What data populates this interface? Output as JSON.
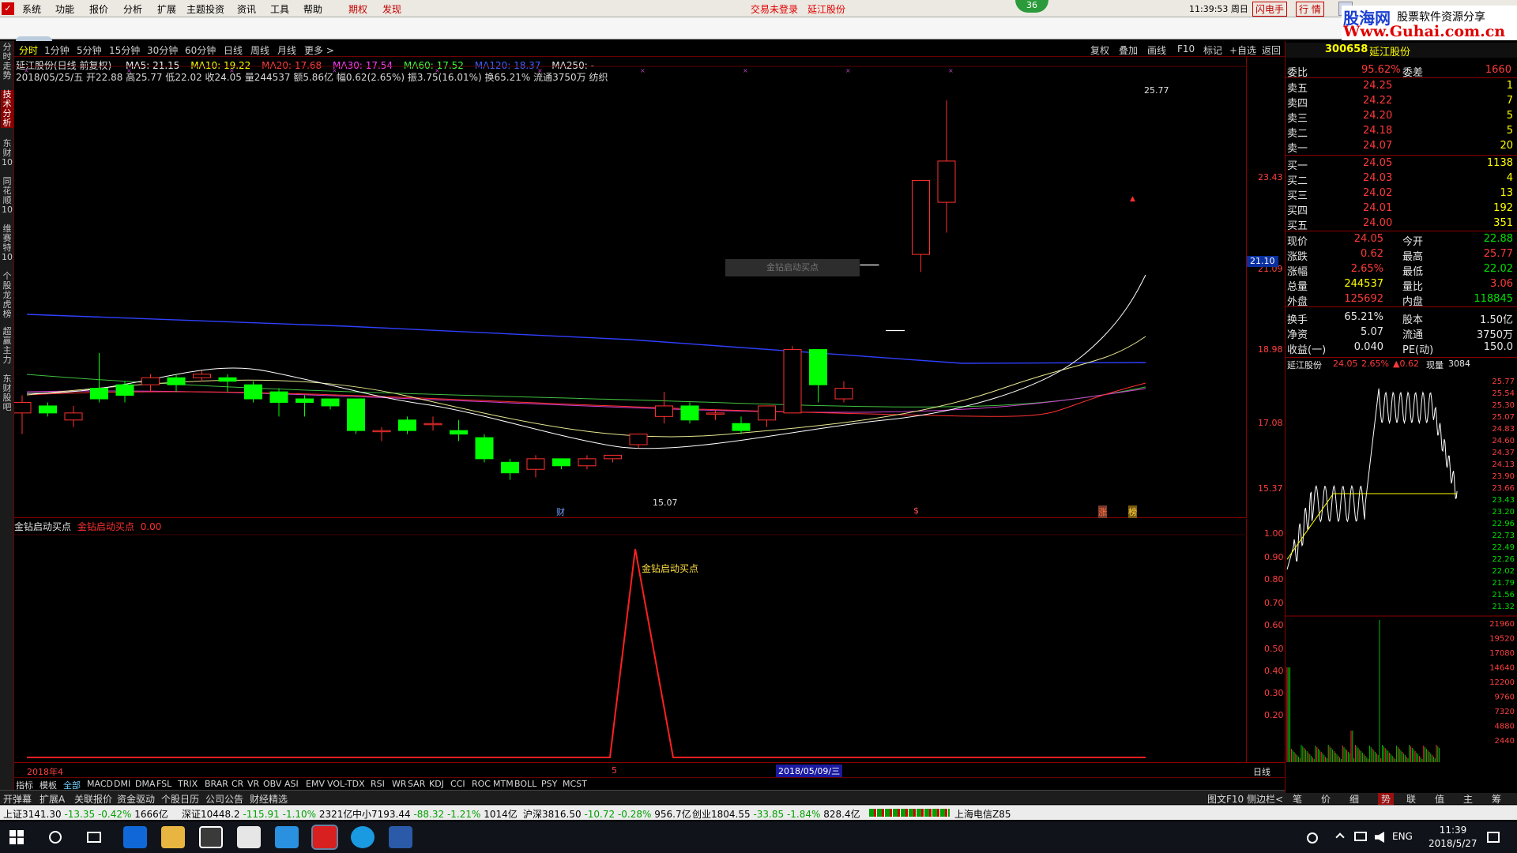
{
  "menu": {
    "items": [
      "系统",
      "功能",
      "报价",
      "分析",
      "扩展",
      "主题投资",
      "资讯",
      "工具",
      "帮助",
      "期权",
      "发现"
    ],
    "center_status": "交易未登录",
    "center_stock": "延江股份",
    "badge": "36",
    "time": "11:39:53 周日",
    "btn_flash": "闪电手",
    "btn_market": "行 情",
    "brand_top": "股海网",
    "brand_top2": "股票软件资源分享",
    "brand_url": "Www.Guhai.com.cn"
  },
  "periods": [
    "分时",
    "1分钟",
    "5分钟",
    "15分钟",
    "30分钟",
    "60分钟",
    "日线",
    "周线",
    "月线",
    "更多 >"
  ],
  "toolbar_right": [
    "复权",
    "叠加",
    "画线",
    "F10",
    "标记",
    "+自选",
    "返回"
  ],
  "left_rail": [
    "分时走势",
    "技术分析",
    "东财10",
    "同花顺10",
    "维赛特10",
    "个股龙虎榜",
    "超赢主力",
    "东财股吧"
  ],
  "chart_header": {
    "line1_name": "延江股份(日线 前复权)",
    "ma5": "MA5: 21.15",
    "ma10": "MA10: 19.22",
    "ma20": "MA20: 17.68",
    "ma30": "MA30: 17.54",
    "ma60": "MA60: 17.52",
    "ma120": "MA120: 18.37",
    "ma250": "MA250: -",
    "line2": "2018/05/25/五 开22.88 高25.77 低22.02 收24.05 量244537 额5.86亿 幅0.62(2.65%) 振3.75(16.01%) 换65.21% 流通3750万 纺织"
  },
  "main_labels": {
    "high_label": "25.77",
    "low_label": "15.07",
    "overlay_text": "金钻启动买点",
    "price_tag": "21.10",
    "bottom_marks": [
      "财",
      "$",
      "涨",
      "榜"
    ]
  },
  "y_axis_main": [
    "23.43",
    "21.09",
    "18.98",
    "17.08",
    "15.37"
  ],
  "sub_header": {
    "name": "金钻启动买点",
    "value_label": "金钻启动买点",
    "value": "0.00"
  },
  "sub_signal_text": "金钻启动买点",
  "y_axis_sub": [
    "1.00",
    "0.90",
    "0.80",
    "0.70",
    "0.60",
    "0.50",
    "0.40",
    "0.30",
    "0.20"
  ],
  "x_axis": {
    "left": "2018年4",
    "mid": "5",
    "date_box": "2018/05/09/三",
    "right": "日线"
  },
  "indicator_tabs": [
    "指标",
    "模板",
    "全部",
    "MACD",
    "DMI",
    "DMA",
    "FSL",
    "TRIX",
    "BRAR",
    "CR",
    "VR",
    "OBV",
    "ASI",
    "EMV",
    "VOL-TDX",
    "RSI",
    "WR",
    "SAR",
    "KDJ",
    "CCI",
    "ROC",
    "MTM",
    "BOLL",
    "PSY",
    "MCST"
  ],
  "func_tabs": [
    "开弹幕",
    "扩展A",
    "关联报价",
    "资金驱动",
    "个股日历",
    "公司公告",
    "财经精选"
  ],
  "func_right": [
    "图文F10",
    "侧边栏<"
  ],
  "right_tabs": [
    "笔",
    "价",
    "细",
    "势",
    "联",
    "值",
    "主",
    "筹"
  ],
  "quote": {
    "code": "300658",
    "name": "延江股份",
    "webi": "委比",
    "webi_v": "95.62%",
    "weicha": "委差",
    "weicha_v": "1660",
    "asks": [
      [
        "卖五",
        "24.25",
        "1"
      ],
      [
        "卖四",
        "24.22",
        "7"
      ],
      [
        "卖三",
        "24.20",
        "5"
      ],
      [
        "卖二",
        "24.18",
        "5"
      ],
      [
        "卖一",
        "24.07",
        "20"
      ]
    ],
    "bids": [
      [
        "买一",
        "24.05",
        "1138"
      ],
      [
        "买二",
        "24.03",
        "4"
      ],
      [
        "买三",
        "24.02",
        "13"
      ],
      [
        "买四",
        "24.01",
        "192"
      ],
      [
        "买五",
        "24.00",
        "351"
      ]
    ],
    "stats": [
      [
        "现价",
        "24.05",
        "今开",
        "22.88"
      ],
      [
        "涨跌",
        "0.62",
        "最高",
        "25.77"
      ],
      [
        "涨幅",
        "2.65%",
        "最低",
        "22.02"
      ],
      [
        "总量",
        "244537",
        "量比",
        "3.06"
      ],
      [
        "外盘",
        "125692",
        "内盘",
        "118845"
      ],
      [
        "换手",
        "65.21%",
        "股本",
        "1.50亿"
      ],
      [
        "净资",
        "5.07",
        "流通",
        "3750万"
      ],
      [
        "收益(一)",
        "0.040",
        "PE(动)",
        "150.0"
      ]
    ]
  },
  "mini": {
    "title": "延江股份",
    "price": "24.05",
    "pct": "2.65%",
    "chg": "▲0.62",
    "vol_label": "现量",
    "vol": "3084",
    "yticks": [
      "25.77",
      "25.54",
      "25.30",
      "25.07",
      "24.83",
      "24.60",
      "24.37",
      "24.13",
      "23.90",
      "23.66",
      "23.43",
      "23.20",
      "22.96",
      "22.73",
      "22.49",
      "22.26",
      "22.02",
      "21.79",
      "21.56",
      "21.32"
    ],
    "vticks": [
      "21960",
      "19520",
      "17080",
      "14640",
      "12200",
      "9760",
      "7320",
      "4880",
      "2440"
    ]
  },
  "status": {
    "sh": "上证3141.30",
    "sh_chg": "-13.35",
    "sh_pct": "-0.42%",
    "sh_amt": "1666亿",
    "sz": "深证10448.2",
    "sz_chg": "-115.91",
    "sz_pct": "-1.10%",
    "sz_amt": "2321亿",
    "zx": "中小7193.44",
    "zx_chg": "-88.32",
    "zx_pct": "-1.21%",
    "zx_amt": "1014亿",
    "hs": "沪深3816.50",
    "hs_chg": "-10.72",
    "hs_pct": "-0.28%",
    "hs_amt": "956.7亿",
    "cy": "创业1804.55",
    "cy_chg": "-33.85",
    "cy_pct": "-1.84%",
    "cy_amt": "828.4亿",
    "server": "上海电信Z85"
  },
  "taskbar": {
    "lang": "ENG",
    "time": "11:39",
    "date": "2018/5/27"
  },
  "chart_data": {
    "type": "candlestick",
    "series_ma": [
      "MA5",
      "MA10",
      "MA20",
      "MA30",
      "MA60",
      "MA120"
    ],
    "candles": [
      [
        16.9,
        17.2,
        16.3,
        17.4
      ],
      [
        17.1,
        16.9,
        16.8,
        17.2
      ],
      [
        16.7,
        16.9,
        16.5,
        17.1
      ],
      [
        17.6,
        17.3,
        17.2,
        18.6
      ],
      [
        17.7,
        17.4,
        17.2,
        17.8
      ],
      [
        17.7,
        17.9,
        17.5,
        18.0
      ],
      [
        17.9,
        17.7,
        17.5,
        18.0
      ],
      [
        17.9,
        18.0,
        17.8,
        18.1
      ],
      [
        17.9,
        17.8,
        17.5,
        18.0
      ],
      [
        17.7,
        17.3,
        17.2,
        17.8
      ],
      [
        17.5,
        17.2,
        16.8,
        17.6
      ],
      [
        17.3,
        17.2,
        16.8,
        17.4
      ],
      [
        17.3,
        17.1,
        17.0,
        17.3
      ],
      [
        17.3,
        16.4,
        16.3,
        17.3
      ],
      [
        16.4,
        16.4,
        16.1,
        16.5
      ],
      [
        16.7,
        16.4,
        16.3,
        16.8
      ],
      [
        16.6,
        16.6,
        16.4,
        16.8
      ],
      [
        16.4,
        16.3,
        16.1,
        16.7
      ],
      [
        16.2,
        15.6,
        15.5,
        16.3
      ],
      [
        15.5,
        15.2,
        15.0,
        15.6
      ],
      [
        15.3,
        15.6,
        15.07,
        15.7
      ],
      [
        15.6,
        15.4,
        15.3,
        15.6
      ],
      [
        15.4,
        15.6,
        15.3,
        15.7
      ],
      [
        15.6,
        15.7,
        15.5,
        15.7
      ],
      [
        16.0,
        16.3,
        15.9,
        16.3
      ],
      [
        16.8,
        17.1,
        16.6,
        17.5
      ],
      [
        17.1,
        16.7,
        16.6,
        17.2
      ],
      [
        16.9,
        16.9,
        16.7,
        17.0
      ],
      [
        16.6,
        16.4,
        16.3,
        16.8
      ],
      [
        16.7,
        17.1,
        16.5,
        17.1
      ],
      [
        16.9,
        18.7,
        16.9,
        18.8
      ],
      [
        18.7,
        17.7,
        17.2,
        18.7
      ],
      [
        17.3,
        17.6,
        17.2,
        17.8
      ],
      [
        21.1,
        21.1,
        21.1,
        21.1
      ],
      [
        19.24,
        19.24,
        19.24,
        19.24
      ],
      [
        21.4,
        23.5,
        20.9,
        23.5
      ],
      [
        22.88,
        24.05,
        22.02,
        25.77
      ]
    ]
  }
}
